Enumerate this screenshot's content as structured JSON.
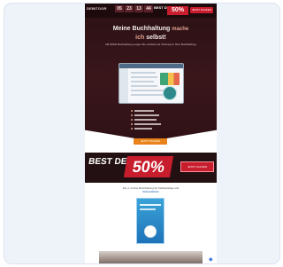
{
  "header": {
    "logo": "DEBITOOR",
    "countdown": [
      "05",
      "23",
      "13",
      "44"
    ],
    "deal_small": "BEST DEAL",
    "percent": "50%",
    "button": "JETZT KAUFEN"
  },
  "hero": {
    "headline_a": "Meine Buchhaltung",
    "headline_b": "mache",
    "headline_c": "ich",
    "headline_d": "selbst!",
    "sub": "Mit WISO Buchhaltung sorgen Sie mühelos für Ordnung in Ihrer Buchhaltung",
    "cta": "JETZT KAUFEN"
  },
  "banner": {
    "title": "BEST DEAL",
    "percent": "50%",
    "button": "JETZT KAUFEN"
  },
  "shop": {
    "line1": "Die 1. Online Buchhaltung für Selbständige und",
    "line2": "Unternehmer"
  },
  "colors": {
    "hero_bg": "#2f1216",
    "accent_red": "#c81d2c",
    "cta_orange": "#e8821a",
    "box_blue": "#1f73b8"
  }
}
